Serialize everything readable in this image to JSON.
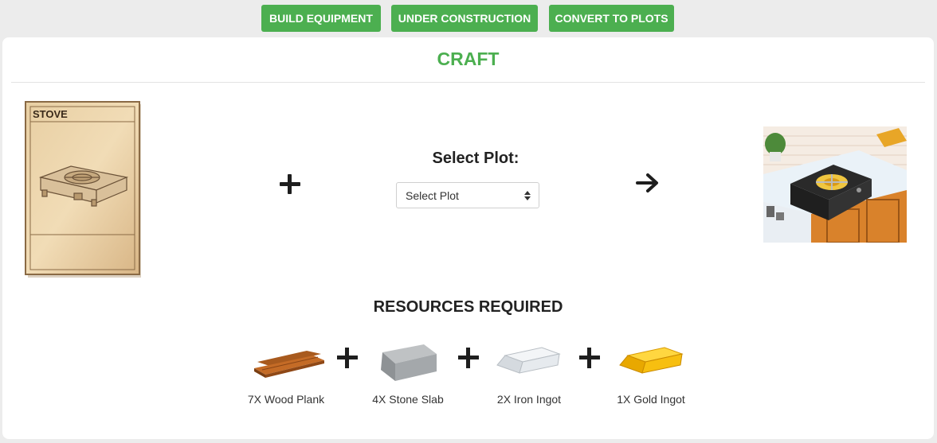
{
  "top_buttons": {
    "build_equipment": "BUILD EQUIPMENT",
    "under_construction": "UNDER CONSTRUCTION",
    "convert_to_plots": "CONVERT TO PLOTS"
  },
  "craft": {
    "title": "CRAFT",
    "card_name": "STOVE",
    "select_label": "Select Plot:",
    "select_value": "Select Plot"
  },
  "resources": {
    "title": "RESOURCES REQUIRED",
    "items": [
      {
        "label": "7X Wood Plank",
        "icon": "wood-plank-icon"
      },
      {
        "label": "4X Stone Slab",
        "icon": "stone-slab-icon"
      },
      {
        "label": "2X Iron Ingot",
        "icon": "iron-ingot-icon"
      },
      {
        "label": "1X Gold Ingot",
        "icon": "gold-ingot-icon"
      }
    ]
  },
  "colors": {
    "accent_green": "#4caf50",
    "background": "#ececec",
    "panel": "#ffffff"
  }
}
